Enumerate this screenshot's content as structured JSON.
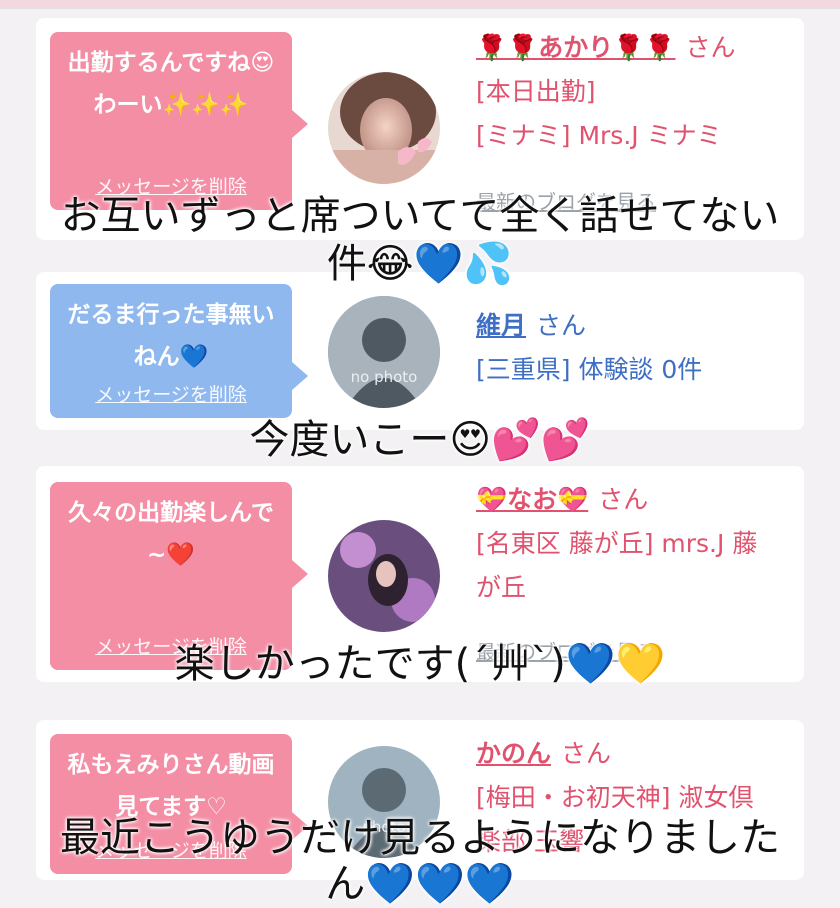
{
  "cards": [
    {
      "message": "出勤するんですね😍わーい✨✨✨",
      "delete_label": "メッセージを削除",
      "name": "🌹🌹あかり🌹🌹",
      "honorific": "さん",
      "status": "[本日出勤]",
      "shop": "[ミナミ] Mrs.J ミナミ",
      "blog_link": "最新のブログを見る",
      "avatar": "photo-woman-pink"
    },
    {
      "message": "だるま行った事無いねん💙",
      "delete_label": "メッセージを削除",
      "name": "維月",
      "honorific": "さん",
      "shop": "[三重県] 体験談 0件",
      "avatar_text": "no photo"
    },
    {
      "message": "久々の出勤楽しんで~❤️",
      "delete_label": "メッセージを削除",
      "name": "💝なお💝",
      "honorific": "さん",
      "shop": "[名東区 藤が丘] mrs.J 藤が丘",
      "blog_link": "最新のブログを見る",
      "avatar": "photo-woman-purple"
    },
    {
      "message": "私もえみりさん動画見てます♡",
      "delete_label": "メッセージを削除",
      "name": "かのん",
      "honorific": "さん",
      "shop": "[梅田・お初天神] 淑女倶楽部 玉響",
      "avatar_text": "photo"
    }
  ],
  "overlays": {
    "o1_line1": "お互いずっと席ついてて全く話せてない",
    "o1_line2": "件😂💙💦",
    "o2": "今度いこー😍💕💕",
    "o3": "楽しかったです(´艸`)💙💛",
    "o4_line1": "最近こうゆうだけ見るようになりました",
    "o4_line2": "ん💙💙💙"
  },
  "colors": {
    "pink_bubble": "#f48ea5",
    "blue_bubble": "#8fb8ef",
    "pink_text": "#e0526e",
    "blue_text": "#3f6fc4"
  }
}
